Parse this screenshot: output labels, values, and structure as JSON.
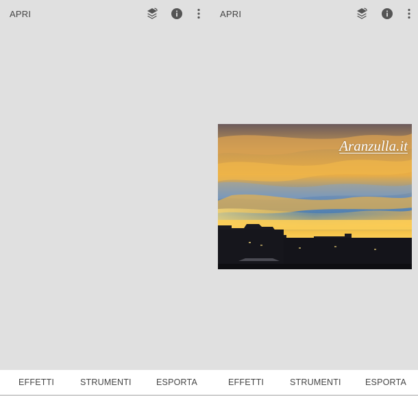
{
  "panels": {
    "left": {
      "open_label": "APRI",
      "tabs": {
        "effects": "EFFETTI",
        "tools": "STRUMENTI",
        "export": "ESPORTA"
      }
    },
    "right": {
      "open_label": "APRI",
      "tabs": {
        "effects": "EFFETTI",
        "tools": "STRUMENTI",
        "export": "ESPORTA"
      },
      "image": {
        "watermark": "Aranzulla.it"
      }
    }
  },
  "icons": {
    "layers": "layers-stack-icon",
    "info": "info-icon",
    "more": "more-vertical-icon"
  },
  "colors": {
    "background": "#e0e0e0",
    "bar": "#ffffff",
    "text": "#444444",
    "icon": "#555555"
  }
}
